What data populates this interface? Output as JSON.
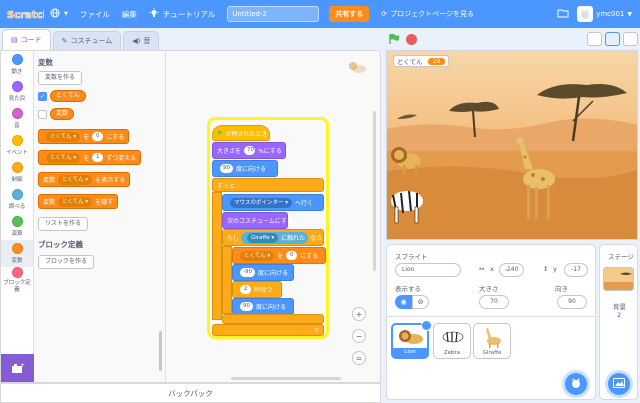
{
  "menubar": {
    "logo": "Scratch",
    "file": "ファイル",
    "edit": "編集",
    "tutorials": "チュートリアル",
    "project_title": "Untitled-2",
    "share": "共有する",
    "see_project_page": "プロジェクトページを見る",
    "username": "ymc001",
    "colors": {
      "bar": "#4c97ff",
      "share": "#ff8c1a"
    }
  },
  "tabs": [
    {
      "label": "コード",
      "icon": "code-icon",
      "active": true
    },
    {
      "label": "コスチューム",
      "icon": "brush-icon",
      "active": false
    },
    {
      "label": "音",
      "icon": "sound-icon",
      "active": false
    }
  ],
  "categories": [
    {
      "label": "動き",
      "color": "#4c97ff"
    },
    {
      "label": "見た目",
      "color": "#9966ff"
    },
    {
      "label": "音",
      "color": "#cf63cf"
    },
    {
      "label": "イベント",
      "color": "#ffbf00"
    },
    {
      "label": "制御",
      "color": "#ffab19"
    },
    {
      "label": "調べる",
      "color": "#5cb1d6"
    },
    {
      "label": "演算",
      "color": "#59c059"
    },
    {
      "label": "変数",
      "color": "#ff8c1a"
    },
    {
      "label": "ブロック定義",
      "color": "#ff6680"
    }
  ],
  "palette": {
    "variables_heading": "変数",
    "make_variable": "変数を作る",
    "variables": [
      {
        "name": "とくてん",
        "checked": true
      },
      {
        "name": "変数",
        "checked": false
      }
    ],
    "set_block": {
      "prefix": "",
      "var": "とくてん",
      "mid": "を",
      "value": "0",
      "suffix": "にする"
    },
    "change_block": {
      "var": "とくてん",
      "mid": "を",
      "value": "1",
      "suffix": "ずつ変える"
    },
    "show_block": {
      "prefix": "変数",
      "var": "とくてん",
      "suffix": "を表示する"
    },
    "hide_block": {
      "prefix": "変数",
      "var": "とくてん",
      "suffix": "を隠す"
    },
    "make_list": "リストを作る",
    "my_blocks_heading": "ブロック定義",
    "make_block": "ブロックを作る"
  },
  "script": {
    "when_flag": "が押されたとき",
    "set_size": {
      "text": "大きさを",
      "value": "70",
      "suffix": "%にする"
    },
    "point_dir": {
      "value": "90",
      "suffix": "度に向ける"
    },
    "forever": "ずっと",
    "go_toward": {
      "target": "マウスのポインター",
      "suffix": "へ行く"
    },
    "next_costume": "次のコスチュームにする",
    "if_touch": {
      "prefix": "もし",
      "target": "Giraffe",
      "mid": "に触れた",
      "suffix": "なら"
    },
    "set_var": {
      "var": "とくてん",
      "mid": "を",
      "value": "0",
      "suffix": "にする"
    },
    "point_dir2": {
      "value": "-90",
      "suffix": "度に向ける"
    },
    "wait": {
      "value": "2",
      "suffix": "秒待つ"
    },
    "point_dir3": {
      "value": "90",
      "suffix": "度に向ける"
    }
  },
  "backpack": "バックパック",
  "stage": {
    "monitor_label": "とくてん",
    "monitor_value": "29"
  },
  "sprite_info": {
    "sprite_label": "スプライト",
    "sprite_name": "Lion",
    "x_label": "x",
    "x_value": "-240",
    "y_label": "y",
    "y_value": "-17",
    "show_label": "表示する",
    "size_label": "大きさ",
    "size_value": "70",
    "direction_label": "向き",
    "direction_value": "90"
  },
  "sprites": [
    {
      "name": "Lion",
      "selected": true
    },
    {
      "name": "Zebra",
      "selected": false
    },
    {
      "name": "Giraffe",
      "selected": false
    }
  ],
  "stage_pane": {
    "label": "ステージ",
    "backdrops_label": "背景",
    "backdrops_count": "2"
  }
}
